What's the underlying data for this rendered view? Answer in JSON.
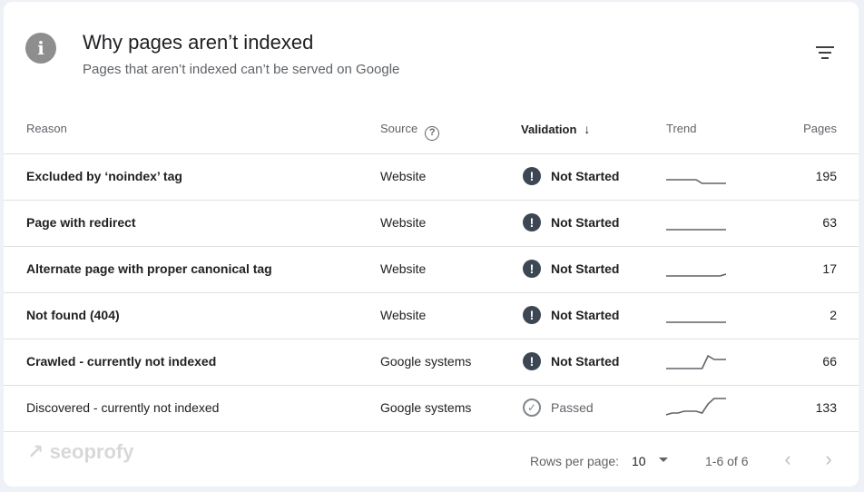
{
  "header": {
    "title": "Why pages aren’t indexed",
    "subtitle": "Pages that aren’t indexed can’t be served on Google",
    "info_icon": "info-icon",
    "filter_icon": "filter-icon"
  },
  "columns": {
    "reason": "Reason",
    "source": "Source",
    "validation": "Validation",
    "trend": "Trend",
    "pages": "Pages"
  },
  "rows": [
    {
      "reason": "Excluded by ‘noindex’ tag",
      "source": "Website",
      "status": "Not Started",
      "status_icon": "exclamation-icon",
      "pages": "195",
      "trend": [
        0.2,
        0.2,
        0.2,
        0.2,
        0.2,
        0.2,
        0.1,
        0.1,
        0.1,
        0.1,
        0.1
      ]
    },
    {
      "reason": "Page with redirect",
      "source": "Website",
      "status": "Not Started",
      "status_icon": "exclamation-icon",
      "pages": "63",
      "trend": [
        0.1,
        0.1,
        0.1,
        0.1,
        0.1,
        0.1,
        0.1,
        0.1,
        0.1,
        0.1,
        0.1
      ]
    },
    {
      "reason": "Alternate page with proper canonical tag",
      "source": "Website",
      "status": "Not Started",
      "status_icon": "exclamation-icon",
      "pages": "17",
      "trend": [
        0.1,
        0.1,
        0.1,
        0.1,
        0.1,
        0.1,
        0.1,
        0.1,
        0.1,
        0.1,
        0.15
      ]
    },
    {
      "reason": "Not found (404)",
      "source": "Website",
      "status": "Not Started",
      "status_icon": "exclamation-icon",
      "pages": "2",
      "trend": [
        0.1,
        0.1,
        0.1,
        0.1,
        0.1,
        0.1,
        0.1,
        0.1,
        0.1,
        0.1,
        0.1
      ]
    },
    {
      "reason": "Crawled - currently not indexed",
      "source": "Google systems",
      "status": "Not Started",
      "status_icon": "exclamation-icon",
      "pages": "66",
      "trend": [
        0.1,
        0.1,
        0.1,
        0.1,
        0.1,
        0.1,
        0.1,
        0.45,
        0.35,
        0.35,
        0.35
      ]
    },
    {
      "reason": "Discovered - currently not indexed",
      "source": "Google systems",
      "status": "Passed",
      "status_icon": "check-circle-icon",
      "pages": "133",
      "trend": [
        0.1,
        0.15,
        0.15,
        0.2,
        0.2,
        0.2,
        0.15,
        0.4,
        0.55,
        0.55,
        0.55
      ]
    }
  ],
  "footer": {
    "watermark": "seoprofy",
    "rows_per_page_label": "Rows per page:",
    "rows_per_page_value": "10",
    "range": "1-6 of 6",
    "prev_icon": "chevron-left-icon",
    "next_icon": "chevron-right-icon"
  }
}
